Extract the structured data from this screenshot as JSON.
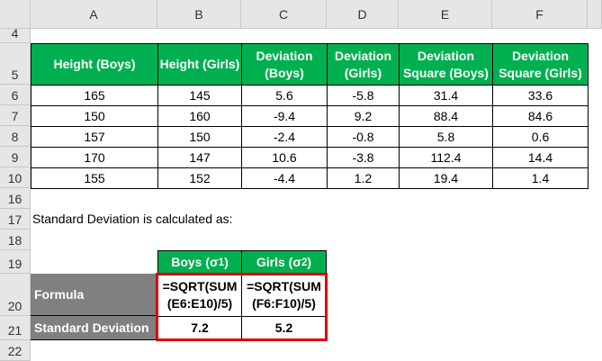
{
  "columns": [
    "A",
    "B",
    "C",
    "D",
    "E",
    "F"
  ],
  "rows": [
    "4",
    "5",
    "6",
    "7",
    "8",
    "9",
    "10",
    "16",
    "17",
    "18",
    "19",
    "20",
    "21",
    "22"
  ],
  "table": {
    "headers": [
      "Height (Boys)",
      "Height (Girls)",
      "Deviation (Boys)",
      "Deviation (Girls)",
      "Deviation Square (Boys)",
      "Deviation Square (Girls)"
    ],
    "data": [
      [
        "165",
        "145",
        "5.6",
        "-5.8",
        "31.4",
        "33.6"
      ],
      [
        "150",
        "160",
        "-9.4",
        "9.2",
        "88.4",
        "84.6"
      ],
      [
        "157",
        "150",
        "-2.4",
        "-0.8",
        "5.8",
        "0.6"
      ],
      [
        "170",
        "147",
        "10.6",
        "-3.8",
        "112.4",
        "14.4"
      ],
      [
        "155",
        "152",
        "-4.4",
        "1.2",
        "19.4",
        "1.4"
      ]
    ]
  },
  "note": "Standard Deviation is calculated as:",
  "sd": {
    "boys_header": "Boys (σ",
    "boys_sub": "1",
    "girls_header": "Girls (σ",
    "girls_sub": "2",
    "close": ")",
    "formula_label": "Formula",
    "sd_label": "Standard Deviation",
    "boys_formula": "=SQRT(SUM (E6:E10)/5)",
    "girls_formula": "=SQRT(SUM (F6:F10)/5)",
    "boys_value": "7.2",
    "girls_value": "5.2"
  }
}
